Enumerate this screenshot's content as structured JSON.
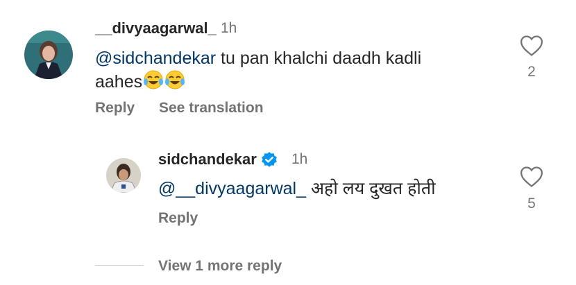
{
  "comments": [
    {
      "username": "__divyaagarwal_",
      "time": "1h",
      "mention": "@sidchandekar",
      "text": " tu pan khalchi daadh kadli",
      "text_line2": "aahes",
      "emoji": "tears-of-joy-emoji",
      "likes": "2",
      "reply_label": "Reply",
      "translate_label": "See translation"
    }
  ],
  "reply": {
    "username": "sidchandekar",
    "verified": true,
    "time": "1h",
    "mention": "@__divyaagarwal_",
    "text": " अहो लय दुखत होती",
    "likes": "5",
    "reply_label": "Reply"
  },
  "view_more_label": "View 1 more reply",
  "colors": {
    "text": "#262626",
    "secondary": "#737373",
    "mention": "#00376b",
    "verified": "#0095f6"
  }
}
